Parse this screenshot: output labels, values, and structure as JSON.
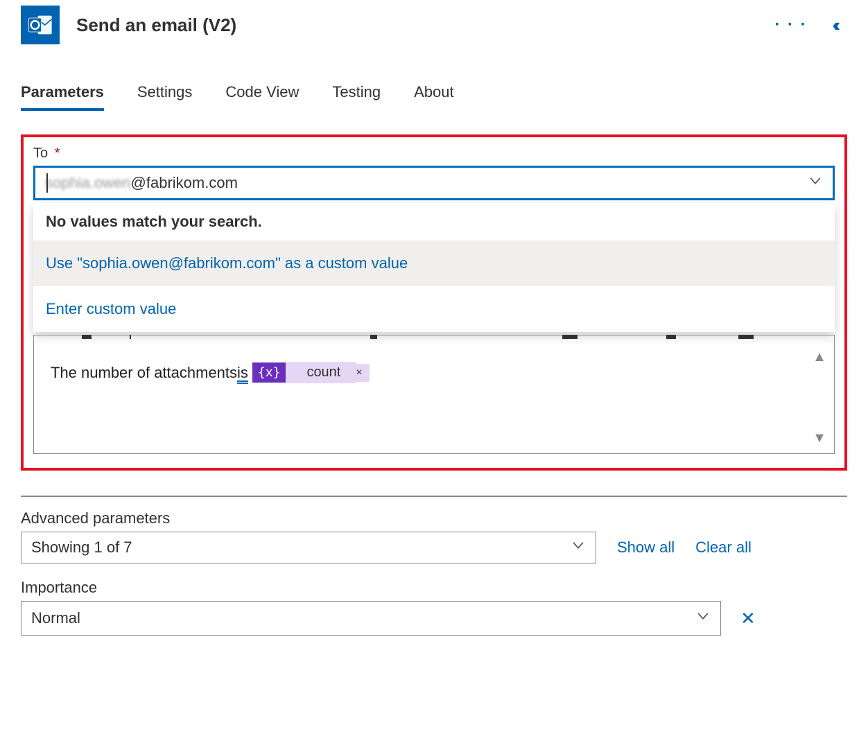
{
  "header": {
    "title": "Send an email (V2)"
  },
  "tabs": [
    "Parameters",
    "Settings",
    "Code View",
    "Testing",
    "About"
  ],
  "active_tab_index": 0,
  "to_field": {
    "label": "To",
    "required_marker": "*",
    "value_blurred": "sophia.owen",
    "value_clear": "@fabrikom.com"
  },
  "dropdown": {
    "no_match": "No values match your search.",
    "use_custom": "Use \"sophia.owen@fabrikom.com\" as a custom value",
    "enter_custom": "Enter custom value"
  },
  "body": {
    "text_prefix": "The number of attachments ",
    "text_is": "is",
    "token_icon": "{x}",
    "token_name": "count",
    "token_remove": "×"
  },
  "advanced": {
    "label": "Advanced parameters",
    "selected": "Showing 1 of 7",
    "show_all": "Show all",
    "clear_all": "Clear all"
  },
  "importance": {
    "label": "Importance",
    "value": "Normal"
  }
}
